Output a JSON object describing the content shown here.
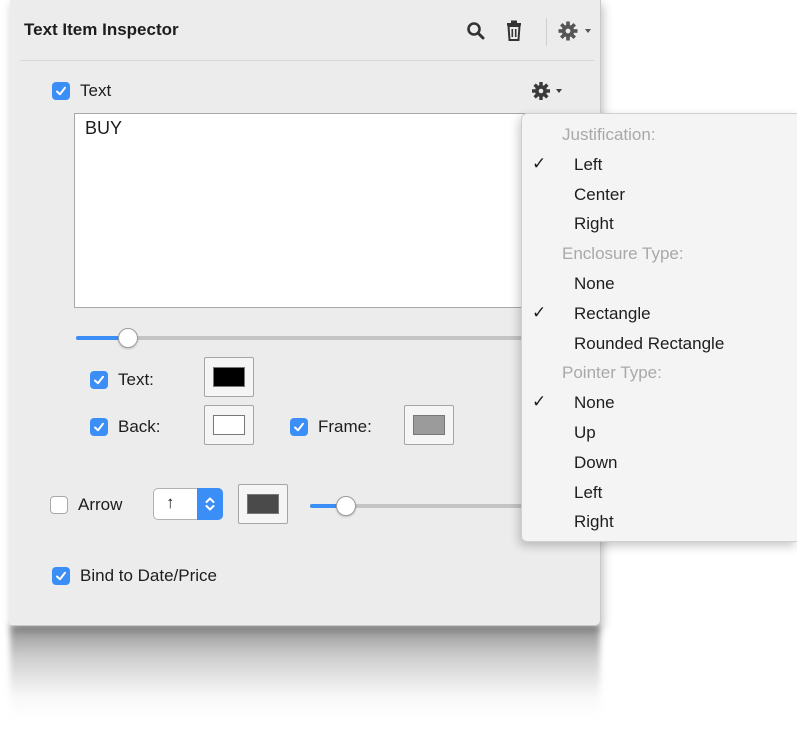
{
  "inspector": {
    "title": "Text Item Inspector",
    "text_section": {
      "label": "Text",
      "checked": true,
      "content": "BUY"
    },
    "text_size_slider": 0.13,
    "colors": {
      "text_label": "Text:",
      "text_checked": true,
      "text_color": "#000000",
      "back_label": "Back:",
      "back_checked": true,
      "back_color": "#ffffff",
      "frame_label": "Frame:",
      "frame_checked": true,
      "frame_color": "#9b9b9b"
    },
    "arrow": {
      "label": "Arrow",
      "checked": false,
      "direction": "↑",
      "color": "#4a4a4a",
      "slider": 0.2
    },
    "bind": {
      "label": "Bind to Date/Price",
      "checked": true
    }
  },
  "menu": {
    "items": [
      {
        "text": "Justification:",
        "header": true
      },
      {
        "text": "Left",
        "checked": true
      },
      {
        "text": "Center"
      },
      {
        "text": "Right"
      },
      {
        "text": "Enclosure Type:",
        "header": true
      },
      {
        "text": "None"
      },
      {
        "text": "Rectangle",
        "checked": true
      },
      {
        "text": "Rounded Rectangle"
      },
      {
        "text": "Pointer Type:",
        "header": true
      },
      {
        "text": "None",
        "checked": true
      },
      {
        "text": "Up"
      },
      {
        "text": "Down"
      },
      {
        "text": "Left"
      },
      {
        "text": "Right"
      }
    ],
    "checkmark": "✓"
  },
  "icons": {
    "search": "search-icon",
    "trash": "trash-icon",
    "gear": "gear-icon"
  },
  "accent_color": "#3a8ef6"
}
